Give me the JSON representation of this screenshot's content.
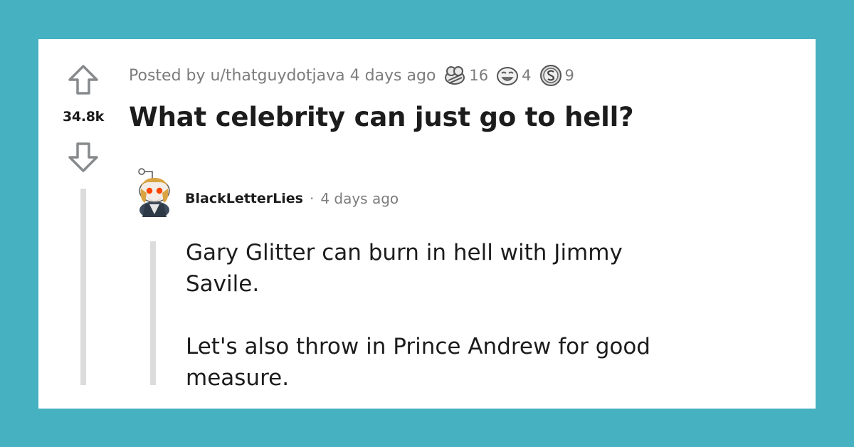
{
  "post": {
    "score": "34.8k",
    "posted_by": "Posted by u/thatguydotjava 4 days ago",
    "title": "What celebrity can just go to hell?",
    "awards": [
      {
        "icon": "wholesome-award-icon",
        "count": "16"
      },
      {
        "icon": "laughing-face-award-icon",
        "count": "4"
      },
      {
        "icon": "silver-award-icon",
        "count": "9"
      }
    ]
  },
  "comment": {
    "author": "BlackLetterLies",
    "separator": "·",
    "time": "4 days ago",
    "paragraphs": [
      "Gary Glitter can burn in hell with Jimmy Savile.",
      "Let's also throw in Prince Andrew for good measure."
    ]
  },
  "colors": {
    "background": "#45b1c1",
    "card": "#ffffff",
    "meta_text": "#7c7c7c",
    "title_text": "#1c1c1c",
    "thread_line": "#dcdcdc"
  }
}
